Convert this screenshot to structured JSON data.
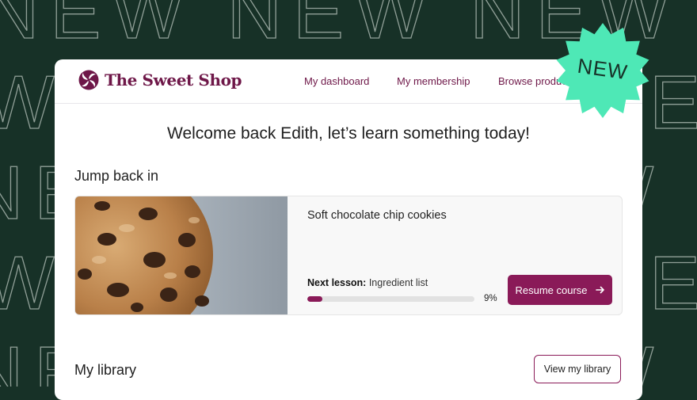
{
  "background": {
    "pattern_word": "NEW",
    "color": "#173127"
  },
  "badge": {
    "label": "NEW",
    "color": "#4ee8b6"
  },
  "nav": {
    "brand": "The Sweet Shop",
    "links": [
      "My dashboard",
      "My membership",
      "Browse produc"
    ]
  },
  "main": {
    "welcome": "Welcome back Edith, let’s learn something today!",
    "jump_back_title": "Jump back in",
    "course": {
      "title": "Soft chocolate chip cookies",
      "next_lesson_label": "Next lesson:",
      "next_lesson_name": " Ingredient list",
      "progress": 0.09,
      "progress_text": "9%",
      "resume_label": "Resume course"
    },
    "library_title": "My library",
    "view_library_label": "View my library"
  },
  "colors": {
    "brand": "#6e1748",
    "accent": "#8a1a58"
  }
}
